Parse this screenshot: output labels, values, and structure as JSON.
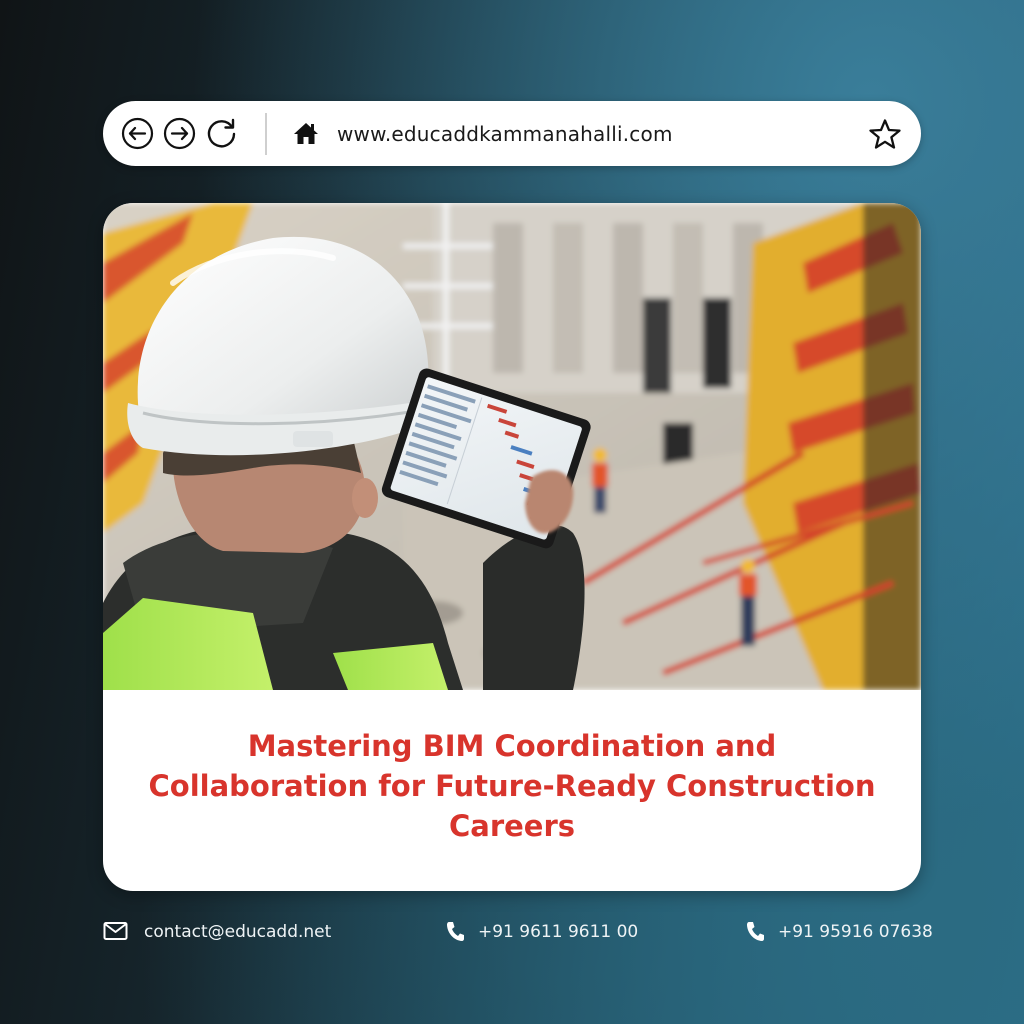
{
  "browser_bar": {
    "url": "www.educaddkammanahalli.com",
    "icons": [
      "back-arrow-icon",
      "forward-arrow-icon",
      "reload-icon",
      "home-icon",
      "star-icon"
    ]
  },
  "card": {
    "title_lines": [
      "Mastering BIM Coordination and",
      "Collaboration for Future-Ready Construction",
      "Careers"
    ],
    "title_color": "#d8342c",
    "photo_icon": "construction-site-photo"
  },
  "footer": {
    "email": "contact@educadd.net",
    "phone_1": "+91 9611 9611 00",
    "phone_2": "+91 95916 07638",
    "icons": [
      "mail-icon",
      "phone-icon",
      "phone-icon"
    ]
  },
  "colors": {
    "background_dark": "#101416",
    "background_teal": "#2d7190",
    "accent_red": "#d8342c",
    "card_bg": "#ffffff"
  }
}
